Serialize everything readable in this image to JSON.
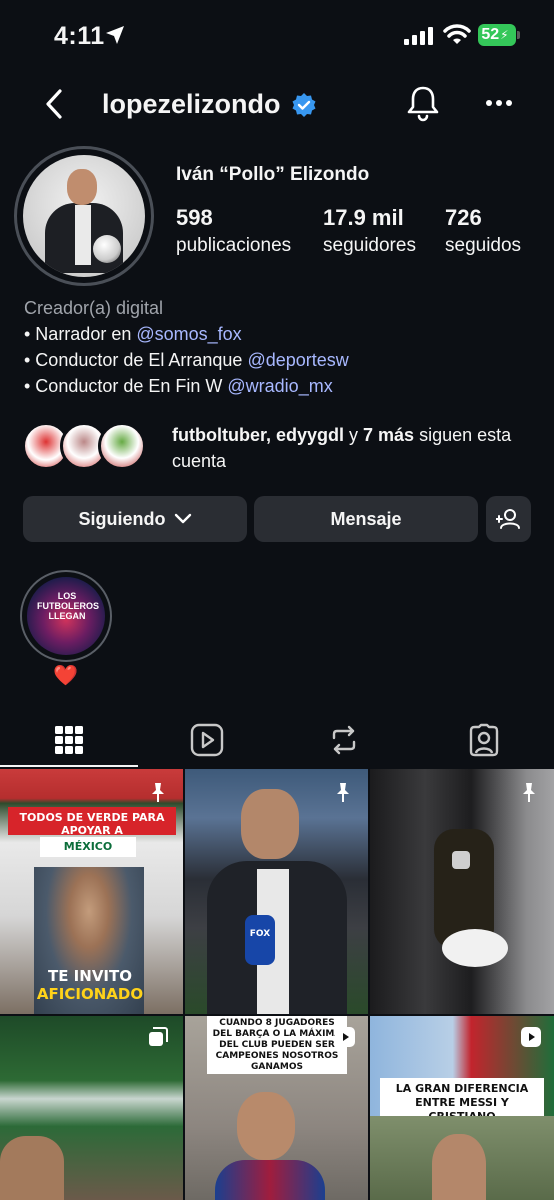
{
  "status_bar": {
    "time": "4:11",
    "battery": "52"
  },
  "nav": {
    "username": "lopezelizondo"
  },
  "profile": {
    "full_name": "Iván “Pollo” Elizondo",
    "stats": [
      {
        "value": "598",
        "label": "publicaciones"
      },
      {
        "value": "17.9 mil",
        "label": "seguidores"
      },
      {
        "value": "726",
        "label": "seguidos"
      }
    ],
    "category": "Creador(a) digital",
    "bio_lines": [
      {
        "text": "• Narrador en ",
        "mention": "@somos_fox"
      },
      {
        "text": "• Conductor de El Arranque ",
        "mention": "@deportesw"
      },
      {
        "text": "• Conductor de En Fin W ",
        "mention": "@wradio_mx"
      }
    ],
    "followed_by": {
      "names": "futboltuber, edyygdl",
      "connector": " y ",
      "more": "7 más",
      "suffix": " siguen esta cuenta"
    }
  },
  "actions": {
    "following": "Siguiendo",
    "message": "Mensaje"
  },
  "highlights": [
    {
      "label": "❤️",
      "cover_text": "LOS FUTBOLEROS LLEGAN"
    }
  ],
  "posts": [
    {
      "caption_top": "TODOS DE VERDE PARA APOYAR A",
      "caption_bottom": "MÉXICO",
      "caption_lower": "TE INVITO",
      "caption_lower2": "AFICIONADO",
      "badge": "pin"
    },
    {
      "caption_top": "",
      "mic_label": "FOX",
      "badge": "pin"
    },
    {
      "caption_top": "",
      "badge": "pin"
    },
    {
      "caption_top": "",
      "badge": "carousel"
    },
    {
      "caption_top": "CUANDO 8 JUGADORES DEL BARÇA O LA MÁXIMA DEL CLUB PUEDEN SER CAMPEONES NOSOTROS GANAMOS",
      "badge": "reel"
    },
    {
      "caption_top": "LA GRAN DIFERENCIA ENTRE MESSI Y CRISTIANO",
      "badge": "reel"
    }
  ]
}
